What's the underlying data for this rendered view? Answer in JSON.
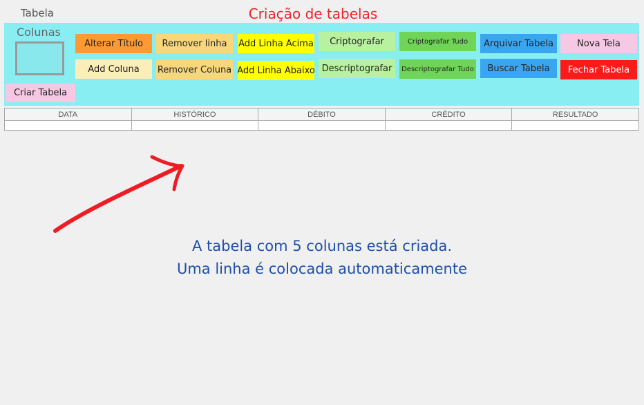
{
  "header": {
    "tab_label": "Tabela",
    "title": "Criação de tabelas"
  },
  "toolbar": {
    "columns_label": "Colunas",
    "buttons": [
      {
        "label": "Alterar Título",
        "color": "#ff9933"
      },
      {
        "label": "Remover linha",
        "color": "#f7d77a"
      },
      {
        "label": "Add Linha Acima",
        "color": "#ffff00"
      },
      {
        "label": "Criptografar",
        "color": "#b8f2a0"
      },
      {
        "label": "Criptografar Tudo",
        "color": "#6fd458"
      },
      {
        "label": "Arquivar Tabela",
        "color": "#3aa6f2"
      },
      {
        "label": "Nova Tela",
        "color": "#f6c8e4"
      },
      {
        "label": "Add Coluna",
        "color": "#fbeeb8"
      },
      {
        "label": "Remover Coluna",
        "color": "#f7d77a"
      },
      {
        "label": "Add Linha Abaixo",
        "color": "#ffff00"
      },
      {
        "label": "Descriptografar",
        "color": "#b8f2a0"
      },
      {
        "label": "Descriptografar Tudo",
        "color": "#6fd458"
      },
      {
        "label": "Buscar Tabela",
        "color": "#3aa6f2"
      },
      {
        "label": "Fechar Tabela",
        "color": "#ff1a1a"
      },
      {
        "label": "Criar Tabela",
        "color": "#f6c8e4"
      }
    ]
  },
  "table": {
    "headers": [
      "DATA",
      "HISTÓRICO",
      "DÉBITO",
      "CRÉDITO",
      "RESULTADO"
    ],
    "rows": [
      [
        "",
        "",
        "",
        "",
        ""
      ]
    ]
  },
  "annotation": {
    "line1": "A tabela com 5 colunas está criada.",
    "line2": "Uma linha é colocada automaticamente",
    "arrow_color": "#ee1c24"
  }
}
